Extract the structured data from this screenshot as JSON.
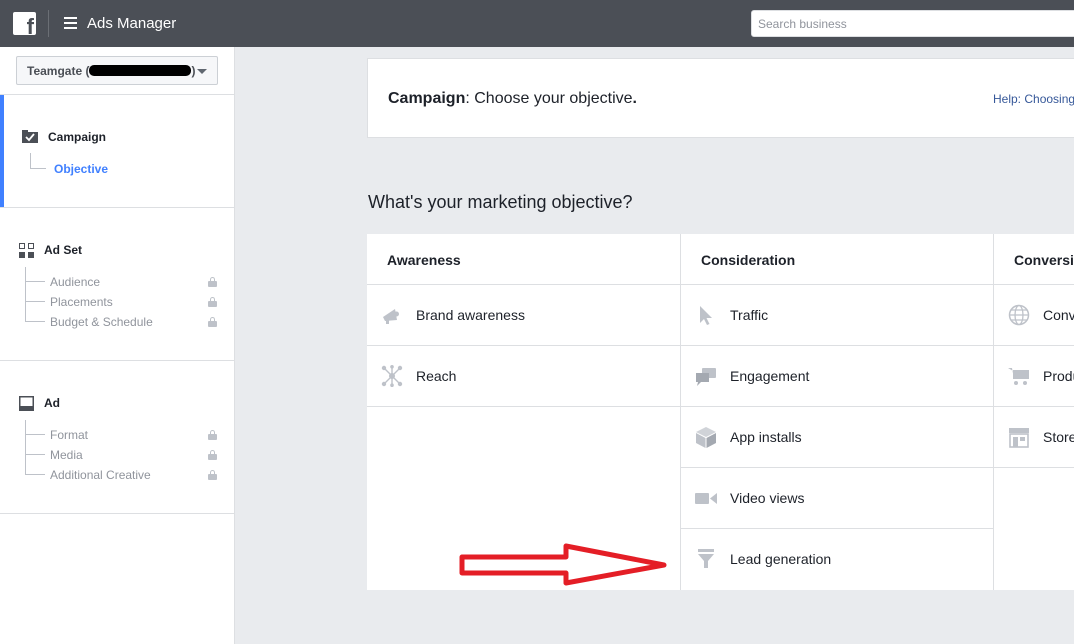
{
  "topbar": {
    "logo": "f",
    "title": "Ads Manager",
    "search_placeholder": "Search business"
  },
  "sidebar": {
    "account": {
      "label_prefix": "Teamgate (",
      "label_suffix": ")"
    },
    "sections": [
      {
        "title": "Campaign",
        "icon": "campaign-check-icon",
        "items": [
          {
            "label": "Objective",
            "active": true,
            "locked": false
          }
        ]
      },
      {
        "title": "Ad Set",
        "icon": "adset-grid-icon",
        "items": [
          {
            "label": "Audience",
            "locked": true
          },
          {
            "label": "Placements",
            "locked": true
          },
          {
            "label": "Budget & Schedule",
            "locked": true
          }
        ]
      },
      {
        "title": "Ad",
        "icon": "ad-layout-icon",
        "items": [
          {
            "label": "Format",
            "locked": true
          },
          {
            "label": "Media",
            "locked": true
          },
          {
            "label": "Additional Creative",
            "locked": true
          }
        ]
      }
    ]
  },
  "header": {
    "title_bold": "Campaign",
    "title_rest": ": Choose your objective",
    "title_period": ".",
    "help": "Help: Choosing"
  },
  "question": "What's your marketing objective?",
  "columns": [
    {
      "title": "Awareness",
      "items": [
        {
          "label": "Brand awareness",
          "icon": "megaphone-icon"
        },
        {
          "label": "Reach",
          "icon": "reach-icon"
        }
      ]
    },
    {
      "title": "Consideration",
      "items": [
        {
          "label": "Traffic",
          "icon": "cursor-icon"
        },
        {
          "label": "Engagement",
          "icon": "chat-bubbles-icon"
        },
        {
          "label": "App installs",
          "icon": "box-icon"
        },
        {
          "label": "Video views",
          "icon": "video-camera-icon"
        },
        {
          "label": "Lead generation",
          "icon": "funnel-icon"
        }
      ]
    },
    {
      "title": "Conversi",
      "items": [
        {
          "label": "Conv",
          "icon": "globe-icon"
        },
        {
          "label": "Produ",
          "icon": "cart-icon"
        },
        {
          "label": "Store",
          "icon": "store-icon"
        }
      ]
    }
  ],
  "colors": {
    "accent": "#4080ff",
    "topbar": "#4b4f56",
    "arrow": "#e41e26"
  }
}
